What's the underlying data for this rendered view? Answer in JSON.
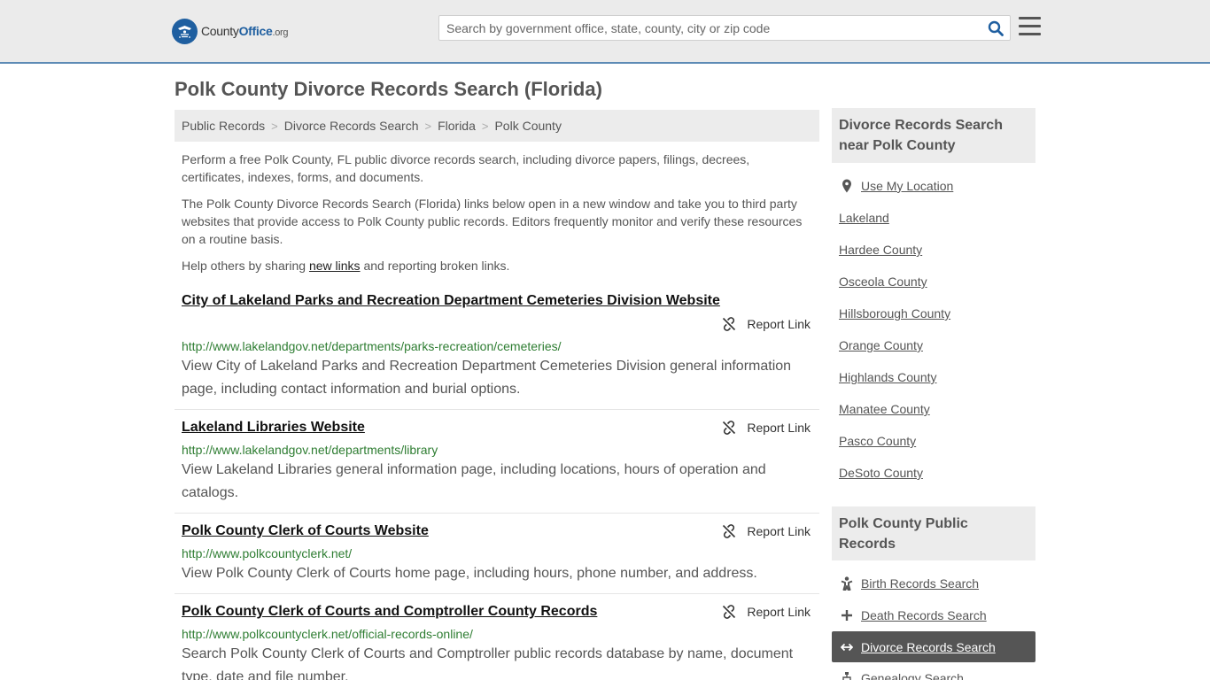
{
  "header": {
    "logo": {
      "name_county": "County",
      "name_office": "Office",
      "name_tld": ".org"
    },
    "search": {
      "placeholder": "Search by government office, state, county, city or zip code",
      "value": ""
    }
  },
  "main": {
    "title": "Polk County Divorce Records Search (Florida)",
    "breadcrumb": [
      "Public Records",
      "Divorce Records Search",
      "Florida",
      "Polk County"
    ],
    "intro": {
      "p1": "Perform a free Polk County, FL public divorce records search, including divorce papers, filings, decrees, certificates, indexes, forms, and documents.",
      "p2": "The Polk County Divorce Records Search (Florida) links below open in a new window and take you to third party websites that provide access to Polk County public records. Editors frequently monitor and verify these resources on a routine basis.",
      "p3_before": "Help others by sharing ",
      "p3_link": "new links",
      "p3_after": " and reporting broken links."
    },
    "report_label": "Report Link",
    "results": [
      {
        "title": "City of Lakeland Parks and Recreation Department Cemeteries Division Website",
        "url": "http://www.lakelandgov.net/departments/parks-recreation/cemeteries/",
        "description": "View City of Lakeland Parks and Recreation Department Cemeteries Division general information page, including contact information and burial options."
      },
      {
        "title": "Lakeland Libraries Website",
        "url": "http://www.lakelandgov.net/departments/library",
        "description": "View Lakeland Libraries general information page, including locations, hours of operation and catalogs."
      },
      {
        "title": "Polk County Clerk of Courts Website",
        "url": "http://www.polkcountyclerk.net/",
        "description": "View Polk County Clerk of Courts home page, including hours, phone number, and address."
      },
      {
        "title": "Polk County Clerk of Courts and Comptroller County Records",
        "url": "http://www.polkcountyclerk.net/official-records-online/",
        "description": "Search Polk County Clerk of Courts and Comptroller public records database by name, document type, date and file number."
      }
    ]
  },
  "sidebar": {
    "nearby": {
      "heading": "Divorce Records Search near Polk County",
      "use_location": "Use My Location",
      "links": [
        "Lakeland",
        "Hardee County",
        "Osceola County",
        "Hillsborough County",
        "Orange County",
        "Highlands County",
        "Manatee County",
        "Pasco County",
        "DeSoto County"
      ]
    },
    "public_records": {
      "heading": "Polk County Public Records",
      "items": [
        {
          "label": "Birth Records Search",
          "icon": "baby-icon"
        },
        {
          "label": "Death Records Search",
          "icon": "cross-icon"
        },
        {
          "label": "Divorce Records Search",
          "icon": "split-arrows-icon",
          "active": true
        },
        {
          "label": "Genealogy Search",
          "icon": "tree-icon"
        }
      ]
    }
  }
}
